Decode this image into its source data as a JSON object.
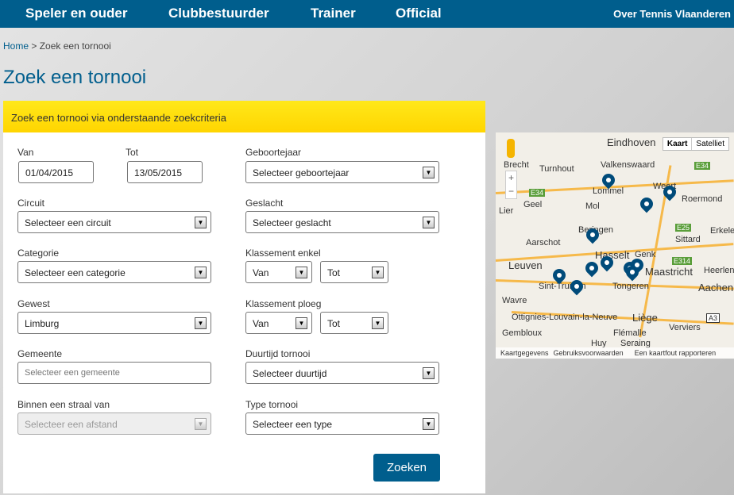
{
  "nav": {
    "items": [
      "Speler en ouder",
      "Clubbestuurder",
      "Trainer",
      "Official"
    ],
    "right": "Over Tennis Vlaanderen"
  },
  "breadcrumb": {
    "home": "Home",
    "sep": ">",
    "current": "Zoek een tornooi"
  },
  "title": "Zoek een tornooi",
  "panel": {
    "header": "Zoek een tornooi via onderstaande zoekcriteria",
    "van": {
      "label": "Van",
      "value": "01/04/2015"
    },
    "tot": {
      "label": "Tot",
      "value": "13/05/2015"
    },
    "geboortejaar": {
      "label": "Geboortejaar",
      "value": "Selecteer geboortejaar"
    },
    "circuit": {
      "label": "Circuit",
      "value": "Selecteer een circuit"
    },
    "geslacht": {
      "label": "Geslacht",
      "value": "Selecteer geslacht"
    },
    "categorie": {
      "label": "Categorie",
      "value": "Selecteer een categorie"
    },
    "klassement_enkel": {
      "label": "Klassement enkel",
      "van": "Van",
      "tot": "Tot"
    },
    "gewest": {
      "label": "Gewest",
      "value": "Limburg"
    },
    "klassement_ploeg": {
      "label": "Klassement ploeg",
      "van": "Van",
      "tot": "Tot"
    },
    "gemeente": {
      "label": "Gemeente",
      "placeholder": "Selecteer een gemeente"
    },
    "duurtijd": {
      "label": "Duurtijd tornooi",
      "value": "Selecteer duurtijd"
    },
    "straal": {
      "label": "Binnen een straal van",
      "value": "Selecteer een afstand"
    },
    "type": {
      "label": "Type tornooi",
      "value": "Selecteer een type"
    },
    "submit": "Zoeken"
  },
  "map": {
    "types": [
      "Kaart",
      "Satelliet"
    ],
    "zoom_in": "+",
    "zoom_out": "−",
    "cities": [
      "Eindhoven",
      "Valkenswaard",
      "Turnhout",
      "Brecht",
      "Lommel",
      "Weert",
      "Roermond",
      "Geel",
      "Mol",
      "Lier",
      "Beringen",
      "Aarschot",
      "Hasselt",
      "Genk",
      "Sittard",
      "Leuven",
      "Maastricht",
      "Sint-Truiden",
      "Tongeren",
      "Aachen",
      "Wavre",
      "Ottignies-Louvain-la-Neuve",
      "Liège",
      "Gembloux",
      "Flémalle",
      "Huy",
      "Seraing",
      "Verviers",
      "Heerlen",
      "Erkelenz"
    ],
    "roads": [
      "E34",
      "E34",
      "E25",
      "E314",
      "A3"
    ],
    "footer": [
      "Kaartgegevens",
      "Gebruiksvoorwaarden",
      "Een kaartfout rapporteren"
    ],
    "pin_color": "#004b7a"
  },
  "colors": {
    "brand": "#005e8d",
    "header_yellow": "#ffdd00"
  }
}
